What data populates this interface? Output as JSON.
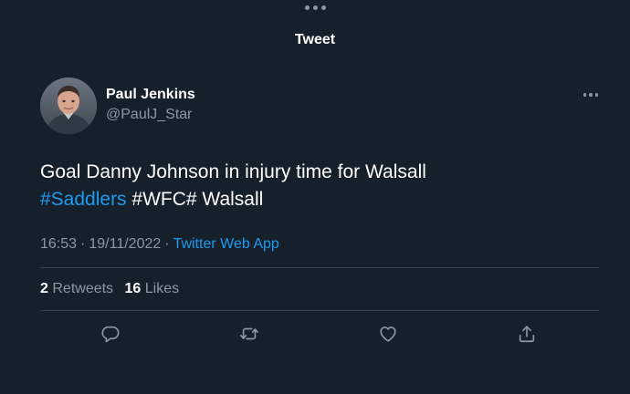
{
  "header": {
    "title": "Tweet"
  },
  "tweet": {
    "author": {
      "name": "Paul Jenkins",
      "handle": "@PaulJ_Star"
    },
    "text_line1": "Goal Danny Johnson in injury time for Walsall",
    "hashtag": "#Saddlers",
    "text_line2_rest": " #WFC# Walsall",
    "time": "16:53",
    "separator": "·",
    "date": "19/11/2022",
    "source": "Twitter Web App",
    "stats": {
      "retweets_count": "2",
      "retweets_label": "Retweets",
      "likes_count": "16",
      "likes_label": "Likes"
    }
  },
  "actions": [
    {
      "name": "reply",
      "icon": "reply-icon"
    },
    {
      "name": "retweet",
      "icon": "retweet-icon"
    },
    {
      "name": "like",
      "icon": "heart-icon"
    },
    {
      "name": "share",
      "icon": "share-icon"
    }
  ],
  "colors": {
    "background": "#15202b",
    "text": "#ffffff",
    "secondary": "#8b98a5",
    "link": "#1d9bf0",
    "divider": "#38444d"
  }
}
